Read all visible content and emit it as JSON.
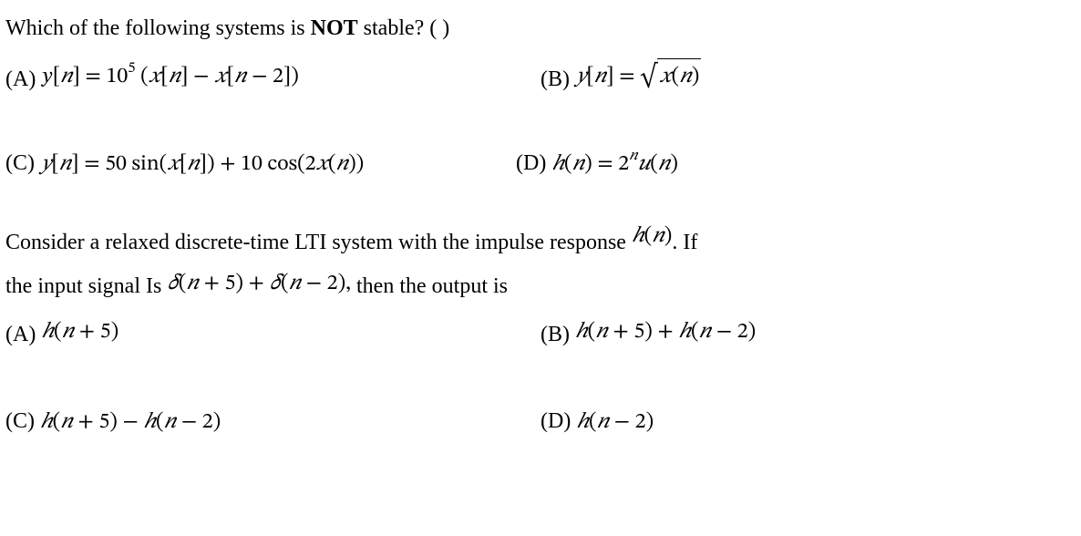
{
  "q1": {
    "prompt_pre": "Which of the following systems is ",
    "prompt_bold": "NOT",
    "prompt_post": " stable? (   )",
    "optA_label": "(A) ",
    "optA_math": "y[n] = 10⁵ (x[n] − x[n − 2])",
    "optB_label": "(B) ",
    "optB_pre": "y[n] = ",
    "optB_sqrt": "x(n)",
    "optC_label": "(C) ",
    "optC_math": "y[n] = 50 sin(x[n]) + 10 cos(2x(n))",
    "optD_label": "(D)   ",
    "optD_math": "h(n) = 2ⁿu(n)"
  },
  "q2": {
    "line1_pre": "Consider a relaxed discrete-time LTI system with the impulse response ",
    "line1_hn": "h(n)",
    "line1_post": ". If",
    "line2_pre": "the input signal Is ",
    "line2_mid": "δ(n + 5) + δ(n − 2),",
    "line2_post": "   then the output is",
    "optA_label": "(A) ",
    "optA_math": "h(n + 5)",
    "optB_label": "(B) ",
    "optB_math": "h(n + 5) + h(n − 2)",
    "optC_label": "(C) ",
    "optC_math": "h(n + 5) − h(n − 2)",
    "optD_label": "(D) ",
    "optD_math": "h(n − 2)"
  }
}
